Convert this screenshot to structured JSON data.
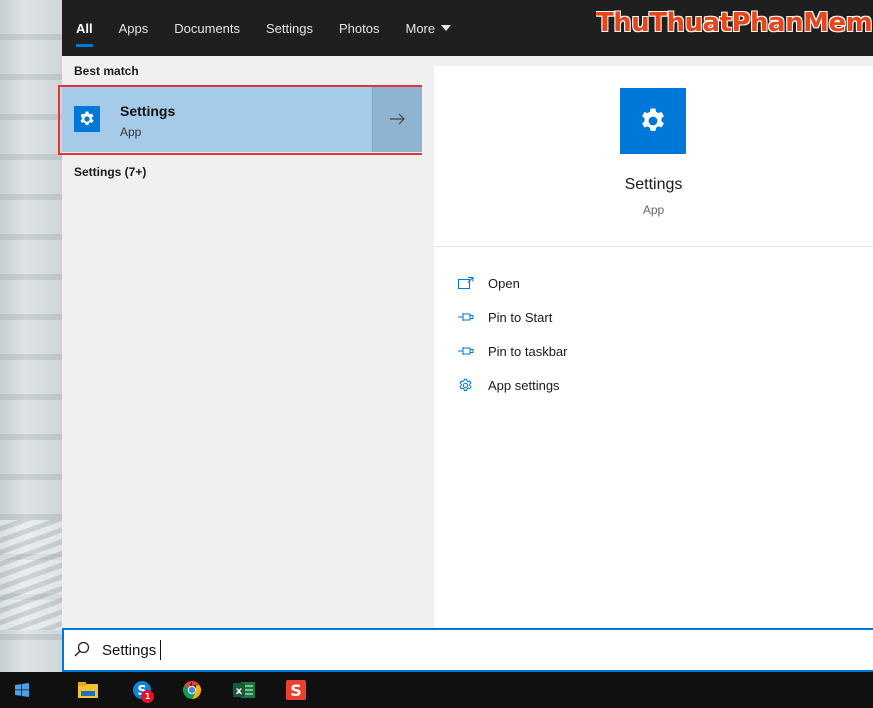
{
  "search_tabs": [
    {
      "label": "All",
      "active": true
    },
    {
      "label": "Apps",
      "active": false
    },
    {
      "label": "Documents",
      "active": false
    },
    {
      "label": "Settings",
      "active": false
    },
    {
      "label": "Photos",
      "active": false
    },
    {
      "label": "More",
      "active": false
    }
  ],
  "watermark": "ThuThuatPhanMem.vn",
  "results": {
    "best_match_label": "Best match",
    "best_match": {
      "title": "Settings",
      "subtitle": "App",
      "icon": "gear-icon"
    },
    "group_label": "Settings (7+)"
  },
  "preview": {
    "title": "Settings",
    "subtitle": "App",
    "icon": "gear-icon",
    "actions": [
      {
        "label": "Open",
        "icon": "open-window-icon"
      },
      {
        "label": "Pin to Start",
        "icon": "pin-icon"
      },
      {
        "label": "Pin to taskbar",
        "icon": "pin-icon"
      },
      {
        "label": "App settings",
        "icon": "gear-outline-icon"
      }
    ]
  },
  "search": {
    "value": "Settings",
    "icon": "search-icon"
  },
  "taskbar": {
    "items": [
      {
        "name": "start-button",
        "icon": "windows-logo-icon"
      },
      {
        "name": "file-explorer",
        "icon": "folder-icon"
      },
      {
        "name": "skype",
        "icon": "skype-icon",
        "badge": "1"
      },
      {
        "name": "chrome",
        "icon": "chrome-icon"
      },
      {
        "name": "excel",
        "icon": "excel-icon"
      },
      {
        "name": "wps",
        "icon": "s-app-icon"
      }
    ]
  },
  "colors": {
    "accent": "#0078d7",
    "selection": "#a6cbe8",
    "highlight_border": "#e2353a",
    "watermark": "#e7461a",
    "dark_bar": "#1f1f1f"
  }
}
